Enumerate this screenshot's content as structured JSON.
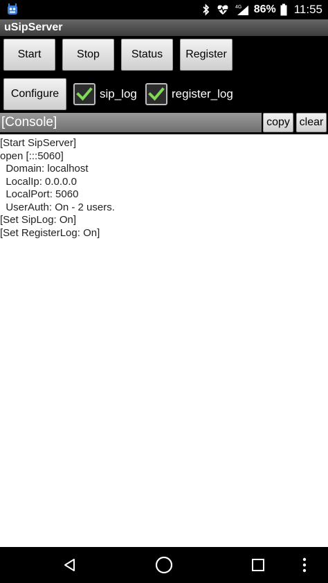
{
  "status_bar": {
    "app_icon": "app-notification-icon",
    "icons": [
      "bluetooth-icon",
      "heart-rate-icon",
      "signal-4g-icon",
      "battery-icon"
    ],
    "network": "4G",
    "battery": "86%",
    "time": "11:55"
  },
  "app": {
    "title": "uSipServer"
  },
  "toolbar": {
    "start_label": "Start",
    "stop_label": "Stop",
    "status_label": "Status",
    "register_label": "Register",
    "configure_label": "Configure",
    "sip_log_label": "sip_log",
    "sip_log_checked": true,
    "register_log_label": "register_log",
    "register_log_checked": true
  },
  "console": {
    "header": "[Console]",
    "copy_label": "copy",
    "clear_label": "clear",
    "lines": [
      "[Start SipServer]",
      "open [:::5060]",
      "  Domain: localhost",
      "  LocalIp: 0.0.0.0",
      "  LocalPort: 5060",
      "  UserAuth: On - 2 users.",
      "[Set SipLog: On]",
      "[Set RegisterLog: On]"
    ]
  },
  "nav": {
    "back": "back-icon",
    "home": "home-icon",
    "recents": "recents-icon",
    "menu": "overflow-menu-icon"
  },
  "colors": {
    "check": "#7ed957",
    "title_bar": "#4a4a4a",
    "console_header": "#858585"
  }
}
